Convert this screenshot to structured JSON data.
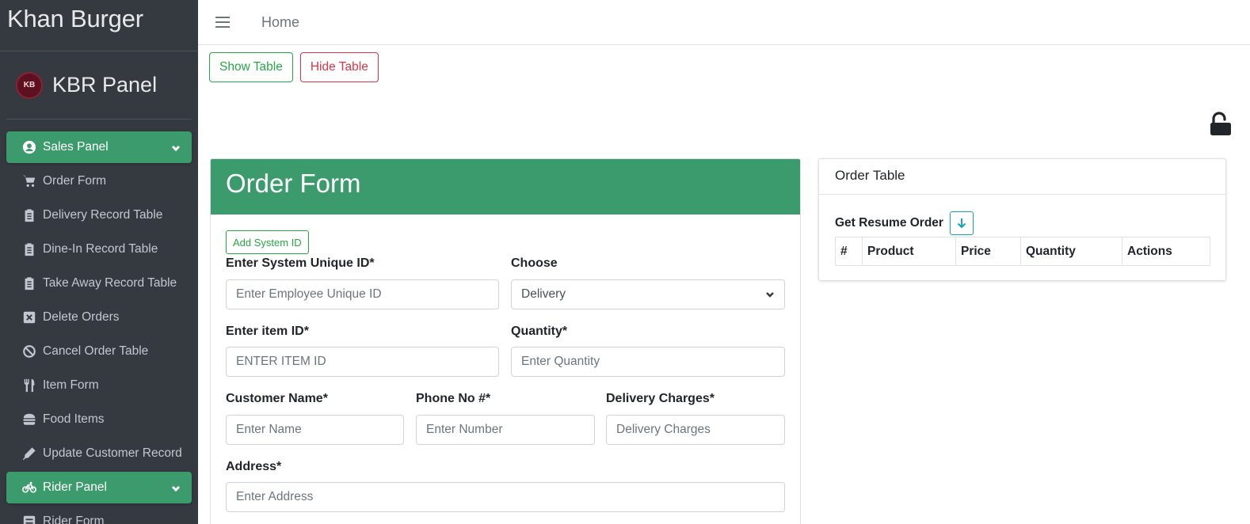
{
  "brand": {
    "title": "Khan Burger"
  },
  "user_panel": {
    "name": "KBR Panel",
    "logo_text": "KB"
  },
  "sidebar": {
    "items": [
      {
        "label": "Sales Panel",
        "icon": "user-circle-icon",
        "active": true
      },
      {
        "label": "Order Form",
        "icon": "cart-icon"
      },
      {
        "label": "Delivery Record Table",
        "icon": "clipboard-icon"
      },
      {
        "label": "Dine-In Record Table",
        "icon": "clipboard-icon"
      },
      {
        "label": "Take Away Record Table",
        "icon": "clipboard-icon"
      },
      {
        "label": "Delete Orders",
        "icon": "x-square-icon"
      },
      {
        "label": "Cancel Order Table",
        "icon": "ban-icon"
      },
      {
        "label": "Item Form",
        "icon": "utensils-icon"
      },
      {
        "label": "Food Items",
        "icon": "hamburger-icon"
      },
      {
        "label": "Update Customer Record",
        "icon": "pen-icon"
      },
      {
        "label": "Rider Panel",
        "icon": "bicycle-icon",
        "active": true
      },
      {
        "label": "Rider Form",
        "icon": "form-icon"
      }
    ]
  },
  "topbar": {
    "home_label": "Home"
  },
  "buttons": {
    "show_table": "Show Table",
    "hide_table": "Hide Table"
  },
  "order_form": {
    "title": "Order Form",
    "add_system_id": "Add System ID",
    "system_id_label": "Enter System Unique ID*",
    "system_id_placeholder": "Enter Employee Unique ID",
    "choose_label": "Choose",
    "choose_value": "Delivery",
    "item_id_label": "Enter item ID*",
    "item_id_placeholder": "ENTER ITEM ID",
    "quantity_label": "Quantity*",
    "quantity_placeholder": "Enter Quantity",
    "customer_name_label": "Customer Name*",
    "customer_name_placeholder": "Enter Name",
    "phone_label": "Phone No #*",
    "phone_placeholder": "Enter Number",
    "delivery_charges_label": "Delivery Charges*",
    "delivery_charges_placeholder": "Delivery Charges",
    "address_label": "Address*",
    "address_placeholder": "Enter Address"
  },
  "order_table": {
    "title": "Order Table",
    "resume_label": "Get Resume Order",
    "columns": [
      "#",
      "Product",
      "Price",
      "Quantity",
      "Actions"
    ]
  },
  "colors": {
    "accent": "#3c9b6d",
    "sidebar_bg": "#343a40",
    "success": "#28a745",
    "danger": "#dc3545",
    "info": "#17a2b8"
  }
}
